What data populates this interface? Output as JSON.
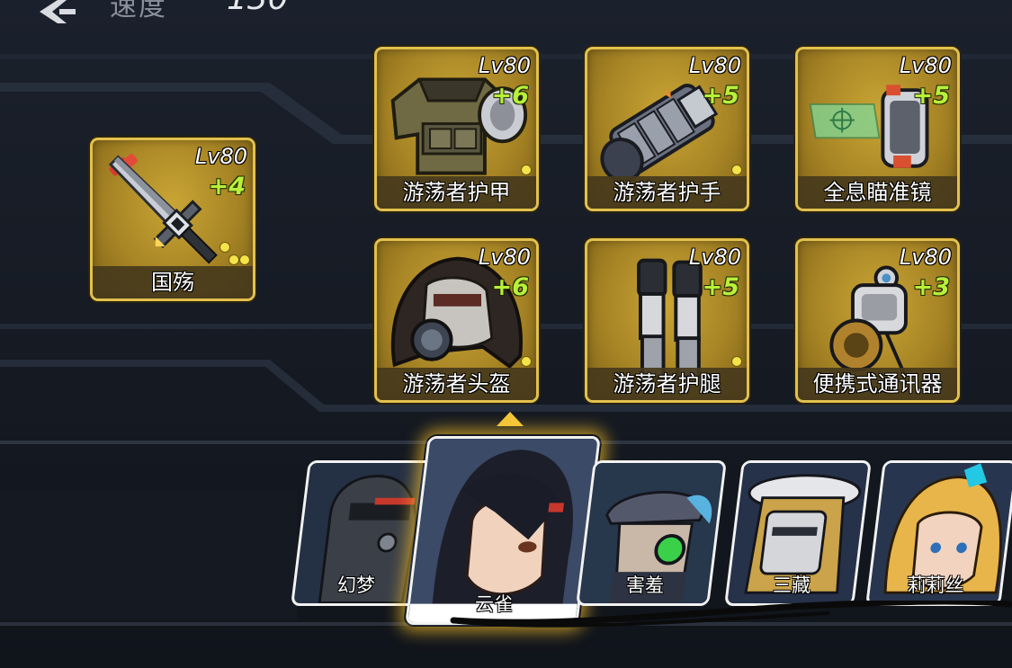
{
  "stat": {
    "label": "速度",
    "value": "130"
  },
  "weapon": {
    "level": "Lv80",
    "plus": "+4",
    "name": "国殇"
  },
  "equipment": [
    {
      "level": "Lv80",
      "plus": "+6",
      "name": "游荡者护甲",
      "icon": "armor-vest-icon"
    },
    {
      "level": "Lv80",
      "plus": "+5",
      "name": "游荡者护手",
      "icon": "gauntlet-icon"
    },
    {
      "level": "Lv80",
      "plus": "+5",
      "name": "全息瞄准镜",
      "icon": "holo-sight-icon"
    },
    {
      "level": "Lv80",
      "plus": "+6",
      "name": "游荡者头盔",
      "icon": "hooded-helmet-icon"
    },
    {
      "level": "Lv80",
      "plus": "+5",
      "name": "游荡者护腿",
      "icon": "leg-armor-icon"
    },
    {
      "level": "Lv80",
      "plus": "+3",
      "name": "便携式通讯器",
      "icon": "communicator-icon"
    }
  ],
  "heroes": [
    {
      "name": "幻梦",
      "selected": false
    },
    {
      "name": "云雀",
      "selected": true
    },
    {
      "name": "害羞",
      "selected": false
    },
    {
      "name": "三藏",
      "selected": false
    },
    {
      "name": "莉莉丝",
      "selected": false
    }
  ],
  "colors": {
    "card_border": "#e2c14e",
    "card_gold": "#b08b28",
    "plus_green": "#b9f03a",
    "dot_yellow": "#f5e34a",
    "selected_glow": "#ffc428"
  }
}
